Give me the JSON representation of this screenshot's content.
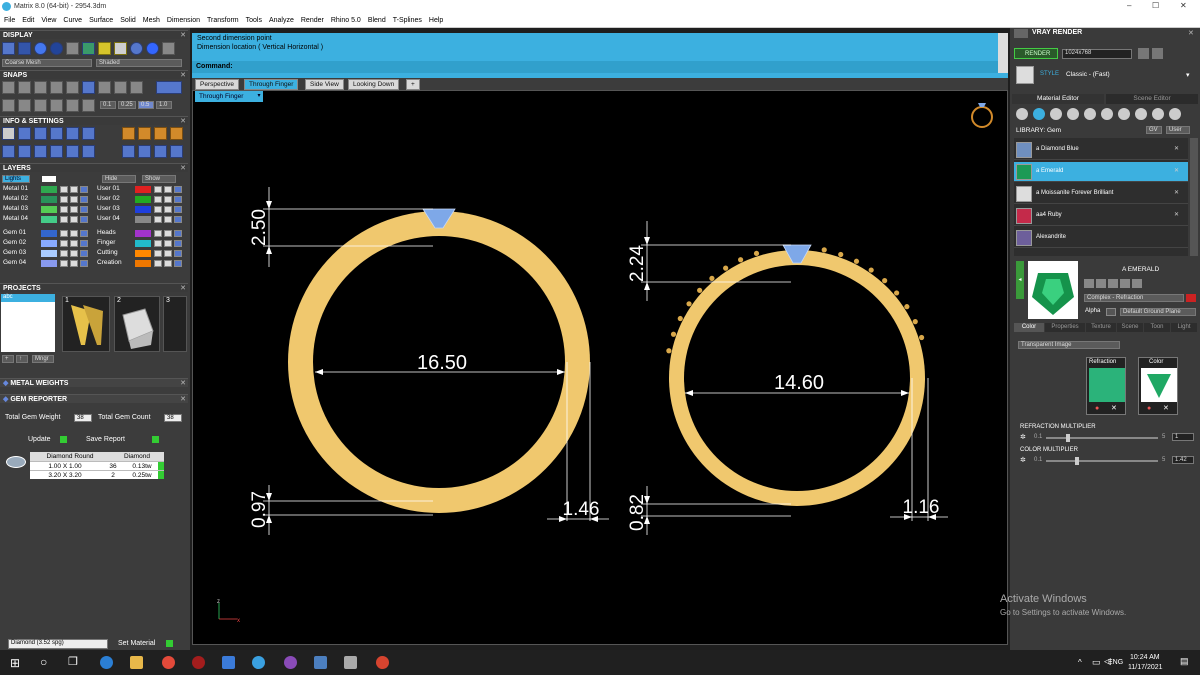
{
  "window": {
    "title": "Matrix 8.0 (64-bit) - 2954.3dm",
    "min": "–",
    "max": "☐",
    "close": "✕"
  },
  "menu": [
    "File",
    "Edit",
    "View",
    "Curve",
    "Surface",
    "Solid",
    "Mesh",
    "Dimension",
    "Transform",
    "Tools",
    "Analyze",
    "Render",
    "Rhino 5.0",
    "Blend",
    "T-Splines",
    "Help"
  ],
  "left": {
    "display": {
      "title": "DISPLAY",
      "mesh_select": "Coarse Mesh",
      "shade_select": "Shaded"
    },
    "snaps": {
      "title": "SNAPS",
      "vals": [
        "0.1",
        "0.25",
        "0.5",
        "1.0"
      ]
    },
    "info": {
      "title": "INFO & SETTINGS"
    },
    "layers": {
      "title": "LAYERS",
      "lights": "Lights",
      "hide": "Hide",
      "show": "Show",
      "left_rows": [
        {
          "name": "Metal 01",
          "color": "#2fa84f"
        },
        {
          "name": "Metal 02",
          "color": "#29935a"
        },
        {
          "name": "Metal 03",
          "color": "#55cc55"
        },
        {
          "name": "Metal 04",
          "color": "#44cc88"
        },
        {
          "name": "Gem 01",
          "color": "#3366cc"
        },
        {
          "name": "Gem 02",
          "color": "#88aaff"
        },
        {
          "name": "Gem 03",
          "color": "#aaccff"
        },
        {
          "name": "Gem 04",
          "color": "#8899ee"
        }
      ],
      "right_rows": [
        {
          "name": "User 01",
          "color": "#e02020"
        },
        {
          "name": "User 02",
          "color": "#22aa22"
        },
        {
          "name": "User 03",
          "color": "#1f3fdd"
        },
        {
          "name": "User 04",
          "color": "#888888"
        },
        {
          "name": "Heads",
          "color": "#a233cc"
        },
        {
          "name": "Finger",
          "color": "#22bbcc"
        },
        {
          "name": "Cutting",
          "color": "#ff8800"
        },
        {
          "name": "Creation",
          "color": "#ee7700"
        }
      ]
    },
    "projects": {
      "title": "PROJECTS",
      "item": "abc",
      "thumbs": [
        "1",
        "2",
        "3"
      ],
      "buttons": [
        "+",
        "↑",
        "Mngr"
      ]
    },
    "metal_weights": {
      "title": "METAL WEIGHTS"
    },
    "gem_reporter": {
      "title": "GEM REPORTER",
      "total_weight_label": "Total Gem Weight",
      "total_weight": "38",
      "total_count_label": "Total Gem Count",
      "total_count": "38",
      "update": "Update",
      "save": "Save Report",
      "headers": [
        "Diamond Round",
        "Diamond"
      ],
      "rows": [
        {
          "size": "1.00 X 1.00",
          "count": "36",
          "weight": "0.13tw"
        },
        {
          "size": "3.20 X 3.20",
          "count": "2",
          "weight": "0.25tw"
        }
      ]
    },
    "material_select": "Diamond  (3.52 spg)",
    "set_material": "Set Material"
  },
  "command": {
    "line1": "Second dimension point",
    "line2": "Dimension location ( Vertical  Horizontal )",
    "label": "Command:"
  },
  "tabs": [
    "Perspective",
    "Through Finger",
    "Side View",
    "Looking Down",
    "+"
  ],
  "viewport_label": "Through Finger",
  "dims": {
    "left": {
      "top": "2.50",
      "diameter": "16.50",
      "bottom": "0.97",
      "side": "1.46"
    },
    "right": {
      "top": "2.24",
      "diameter": "14.60",
      "bottom": "0.82",
      "side": "1.16"
    }
  },
  "axis": {
    "z": "z",
    "x": "x"
  },
  "right": {
    "title": "VRAY RENDER",
    "render": "RENDER",
    "resolution": "1024x768",
    "style_label": "STYLE",
    "style_value": "Classic - (Fast)",
    "tabs": [
      "Material Editor",
      "Scene Editor"
    ],
    "library_label": "LIBRARY: Gem",
    "library_btns": [
      "GV",
      "User"
    ],
    "materials": [
      {
        "name": "a Diamond Blue",
        "color": "#6f8fbf"
      },
      {
        "name": "a Emerald",
        "color": "#1c9a55"
      },
      {
        "name": "a Moissanite Forever Brilliant",
        "color": "#dddddd"
      },
      {
        "name": "aa4 Ruby",
        "color": "#c42a4a"
      },
      {
        "name": "Alexandrite",
        "color": "#6d5f9b"
      }
    ],
    "preview_name": "A EMERALD",
    "type": "Complex - Refraction",
    "alpha": "Alpha",
    "ground": "Default Ground Plane",
    "subtabs": [
      "Color",
      "Properties",
      "Texture",
      "Scene",
      "Toon",
      "Light"
    ],
    "transparent": "Transparent Image",
    "swatch_labels": [
      "Refraction",
      "Color"
    ],
    "refraction_mult": {
      "label": "REFRACTION MULTIPLIER",
      "min": "0.1",
      "max": "5",
      "value": "1"
    },
    "color_mult": {
      "label": "COLOR MULTIPLIER",
      "min": "0.1",
      "max": "5",
      "value": "1.42"
    }
  },
  "watermark": {
    "l1": "Activate Windows",
    "l2": "Go to Settings to activate Windows."
  },
  "taskbar": {
    "time": "10:24 AM",
    "date": "11/17/2021",
    "lang": "ENG"
  },
  "colors": {
    "gold": "#f0c86e",
    "accent": "#3cb0e0",
    "gem": "#7ea8e8"
  }
}
